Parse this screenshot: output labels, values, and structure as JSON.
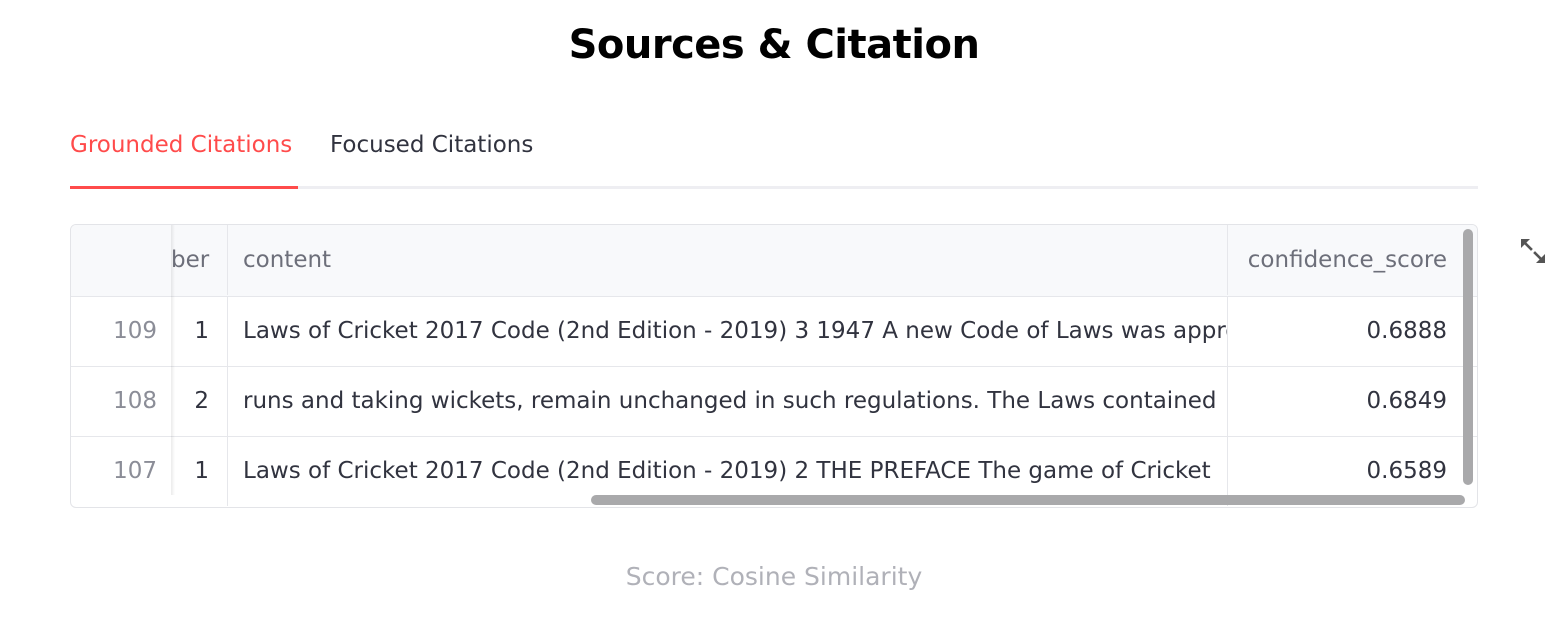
{
  "page": {
    "title": "Sources & Citation",
    "footer": "Score: Cosine Similarity"
  },
  "tabs": [
    {
      "label": "Grounded Citations",
      "active": true
    },
    {
      "label": "Focused Citations",
      "active": false
    }
  ],
  "table": {
    "headers": {
      "index": "",
      "page_number": "ber",
      "content": "content",
      "confidence_score": "confidence_score"
    },
    "rows": [
      {
        "index": "109",
        "page_number": "1",
        "content": "Laws of Cricket 2017 Code (2nd Edition - 2019)    3 1947 A new Code of Laws was appro",
        "confidence_score": "0.6888"
      },
      {
        "index": "108",
        "page_number": "2",
        "content": "runs and taking wickets, remain unchanged in such regulations.  The Laws contained",
        "confidence_score": "0.6849"
      },
      {
        "index": "107",
        "page_number": "1",
        "content": "Laws of Cricket 2017 Code (2nd Edition - 2019)    2 THE PREFACE  The game of Cricket",
        "confidence_score": "0.6589"
      }
    ]
  },
  "icons": {
    "expand": "expand-icon"
  },
  "colors": {
    "accent": "#ff4b4b",
    "text": "#31333f",
    "muted": "#b0b1b8"
  }
}
